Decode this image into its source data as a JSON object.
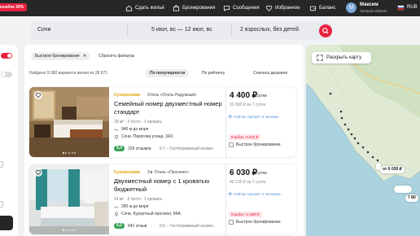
{
  "topbar": {
    "promo": "кэшбэк 30%",
    "nav": [
      {
        "label": "Сдать жильё",
        "icon": "home-icon"
      },
      {
        "label": "Бронирования",
        "icon": "suitcase-icon"
      },
      {
        "label": "Сообщения",
        "icon": "chat-icon"
      },
      {
        "label": "Избранное",
        "icon": "heart-icon"
      },
      {
        "label": "Баланс",
        "icon": "wallet-icon"
      }
    ],
    "user": {
      "initial": "М",
      "name": "Максим",
      "subtitle": "Личный кабинет"
    },
    "currency": "RUB"
  },
  "search": {
    "city": "Сочи",
    "dates": "5 июл, вс — 12 июл, вс",
    "guests": "2 взрослых, без детей"
  },
  "filters": {
    "active_chip": "Быстрое бронирование",
    "reset": "Сбросить фильтры"
  },
  "results": {
    "found": "Найдено 9 982 варианта жилья из 28 871",
    "sort": [
      "По популярности",
      "По рейтингу",
      "Сначала дешевле"
    ]
  },
  "cards": [
    {
      "badge": "Суперхозяин",
      "type": "Отель «Отель Радужный»",
      "title": "Семейный номер двухместный номер стандарт",
      "meta": "18 м² · 2 гостя · 1 кровать",
      "distance": "940 м до моря",
      "address": "Сочи, Пирогова улица, 34/1",
      "rating": "9,4",
      "reviews": "229 отзывов",
      "rating2": "9,7 – Гостеприимный хозяин",
      "price": "4 400 ₽",
      "per": "за сутки",
      "total": "30 800 ₽ за 7 суток",
      "viewing": "Сейчас смотрят 5 человек",
      "cashback": "Кэшбэк +1232 ₽",
      "quick": "Быстрое бронирование"
    },
    {
      "badge": "Суперхозяин",
      "type": "3★ Отель «Проспект»",
      "title": "Двухместный номер с 1 кроватью бюджетный",
      "meta": "14 м² · 2 гостя · 1 кровать",
      "distance": "260 м до моря",
      "address": "Сочи, Курортный проспект, 84А",
      "rating": "9,2",
      "reviews": "641 отзыв",
      "rating2": "9,5 – Гостеприимный хозяин",
      "price": "6 030 ₽",
      "per": "за сутки",
      "total": "42 210 ₽ за 7 суток",
      "viewing": "Сейчас смотрят 4 человека",
      "cashback": "Кэшбэк +1 680 ₽",
      "quick": "Быстрое бронирование"
    }
  ],
  "map": {
    "button": "Раскрыть карту",
    "pins": [
      "от 6 030 ₽",
      "7 80"
    ]
  },
  "colors": {
    "accent": "#e8213d",
    "dark": "#262626",
    "green": "#37a054",
    "super": "#e2a200"
  }
}
